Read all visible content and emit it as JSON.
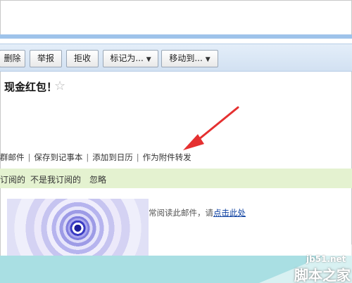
{
  "toolbar": {
    "buttons": [
      {
        "label": "删除"
      },
      {
        "label": "举报"
      },
      {
        "label": "拒收"
      },
      {
        "label": "标记为..."
      },
      {
        "label": "移动到..."
      }
    ]
  },
  "mail": {
    "subject": "现金红包！",
    "actions": [
      "群邮件",
      "保存到记事本",
      "添加到日历",
      "作为附件转发"
    ],
    "subscription_bar": [
      "订阅的",
      "不是我订阅的",
      "忽略"
    ],
    "body_text": "常阅读此邮件，请",
    "body_link": "点击此处"
  },
  "watermark": {
    "site": "jb51.net",
    "name": "脚本之家"
  },
  "colors": {
    "toolbar_bg": "#d8e6f5",
    "green_bar": "#e4f2d0",
    "cyan_bar": "#a9dfe3",
    "arrow": "#e53030",
    "link": "#0b3fa0"
  },
  "icons": {
    "star": "star-outline-icon",
    "dropdown": "chevron-down-icon",
    "arrow": "red-arrow-annotation"
  }
}
